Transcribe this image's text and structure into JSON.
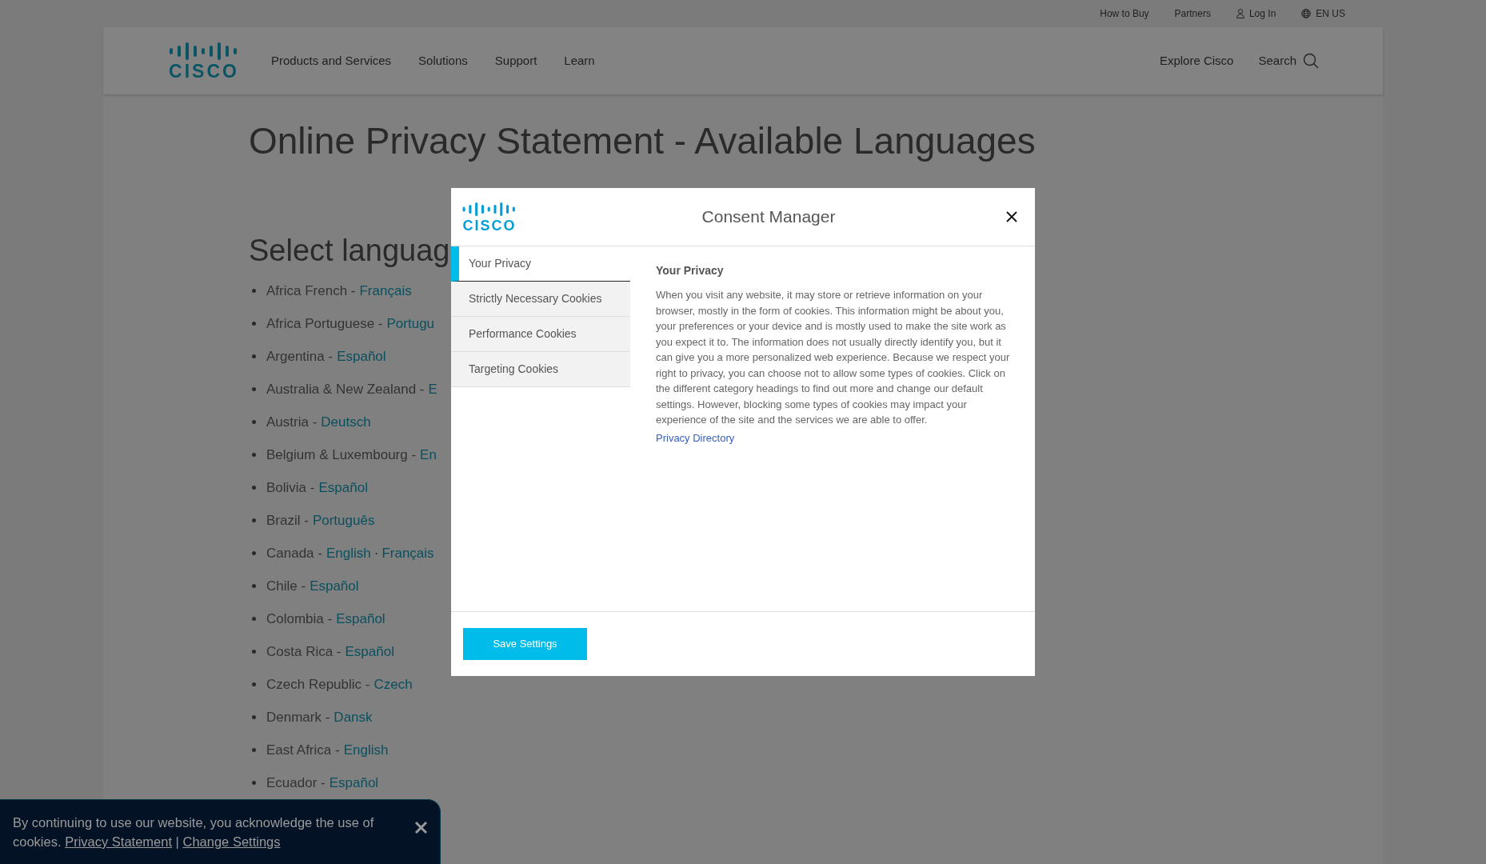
{
  "top_bar": {
    "links": [
      {
        "label": "How to Buy",
        "kind": "link"
      },
      {
        "label": "Partners",
        "kind": "link"
      },
      {
        "label": "Log In",
        "kind": "account"
      },
      {
        "label": "EN US",
        "kind": "locale"
      }
    ]
  },
  "nav": {
    "logo": "CISCO",
    "items": [
      "Products and Services",
      "Solutions",
      "Support",
      "Learn"
    ],
    "explore": "Explore Cisco",
    "search": "Search"
  },
  "page": {
    "title": "Online Privacy Statement - Available Languages",
    "section_title": "Select languag",
    "languages": [
      {
        "label": "Africa French -",
        "links": [
          "Français"
        ]
      },
      {
        "label": "Africa Portuguese -",
        "links": [
          "Portugu"
        ]
      },
      {
        "label": "Argentina -",
        "links": [
          "Español"
        ]
      },
      {
        "label": "Australia & New Zealand -",
        "links": [
          "E"
        ]
      },
      {
        "label": "Austria -",
        "links": [
          "Deutsch"
        ]
      },
      {
        "label": "Belgium & Luxembourg -",
        "links": [
          "En"
        ]
      },
      {
        "label": "Bolivia -",
        "links": [
          "Español"
        ]
      },
      {
        "label": "Brazil -",
        "links": [
          "Português"
        ]
      },
      {
        "label": "Canada -",
        "links": [
          "English",
          "Français"
        ],
        "separator": "·"
      },
      {
        "label": "Chile -",
        "links": [
          "Español"
        ]
      },
      {
        "label": "Colombia -",
        "links": [
          "Español"
        ]
      },
      {
        "label": "Costa Rica -",
        "links": [
          "Español"
        ]
      },
      {
        "label": "Czech Republic -",
        "links": [
          "Czech"
        ]
      },
      {
        "label": "Denmark -",
        "links": [
          "Dansk"
        ]
      },
      {
        "label": "East Africa -",
        "links": [
          "English"
        ]
      },
      {
        "label": "Ecuador -",
        "links": [
          "Español"
        ]
      }
    ]
  },
  "modal": {
    "logo": "CISCO",
    "title": "Consent Manager",
    "menu": [
      {
        "label": "Your Privacy",
        "selected": true
      },
      {
        "label": "Strictly Necessary Cookies",
        "selected": false
      },
      {
        "label": "Performance Cookies",
        "selected": false
      },
      {
        "label": "Targeting Cookies",
        "selected": false
      }
    ],
    "heading": "Your Privacy",
    "body": "When you visit any website, it may store or retrieve information on your browser, mostly in the form of cookies. This information might be about you, your preferences or your device and is mostly used to make the site work as you expect it to. The information does not usually directly identify you, but it can give you a more personalized web experience. Because we respect your right to privacy, you can choose not to allow some types of cookies. Click on the different category headings to find out more and change our default settings. However, blocking some types of cookies may impact your experience of the site and the services we are able to offer.",
    "link": "Privacy Directory",
    "save_button": "Save Settings"
  },
  "banner": {
    "text": "By continuing to use our website, you acknowledge the use of cookies.",
    "links": [
      "Privacy Statement",
      "Change Settings"
    ],
    "separator": "|"
  }
}
